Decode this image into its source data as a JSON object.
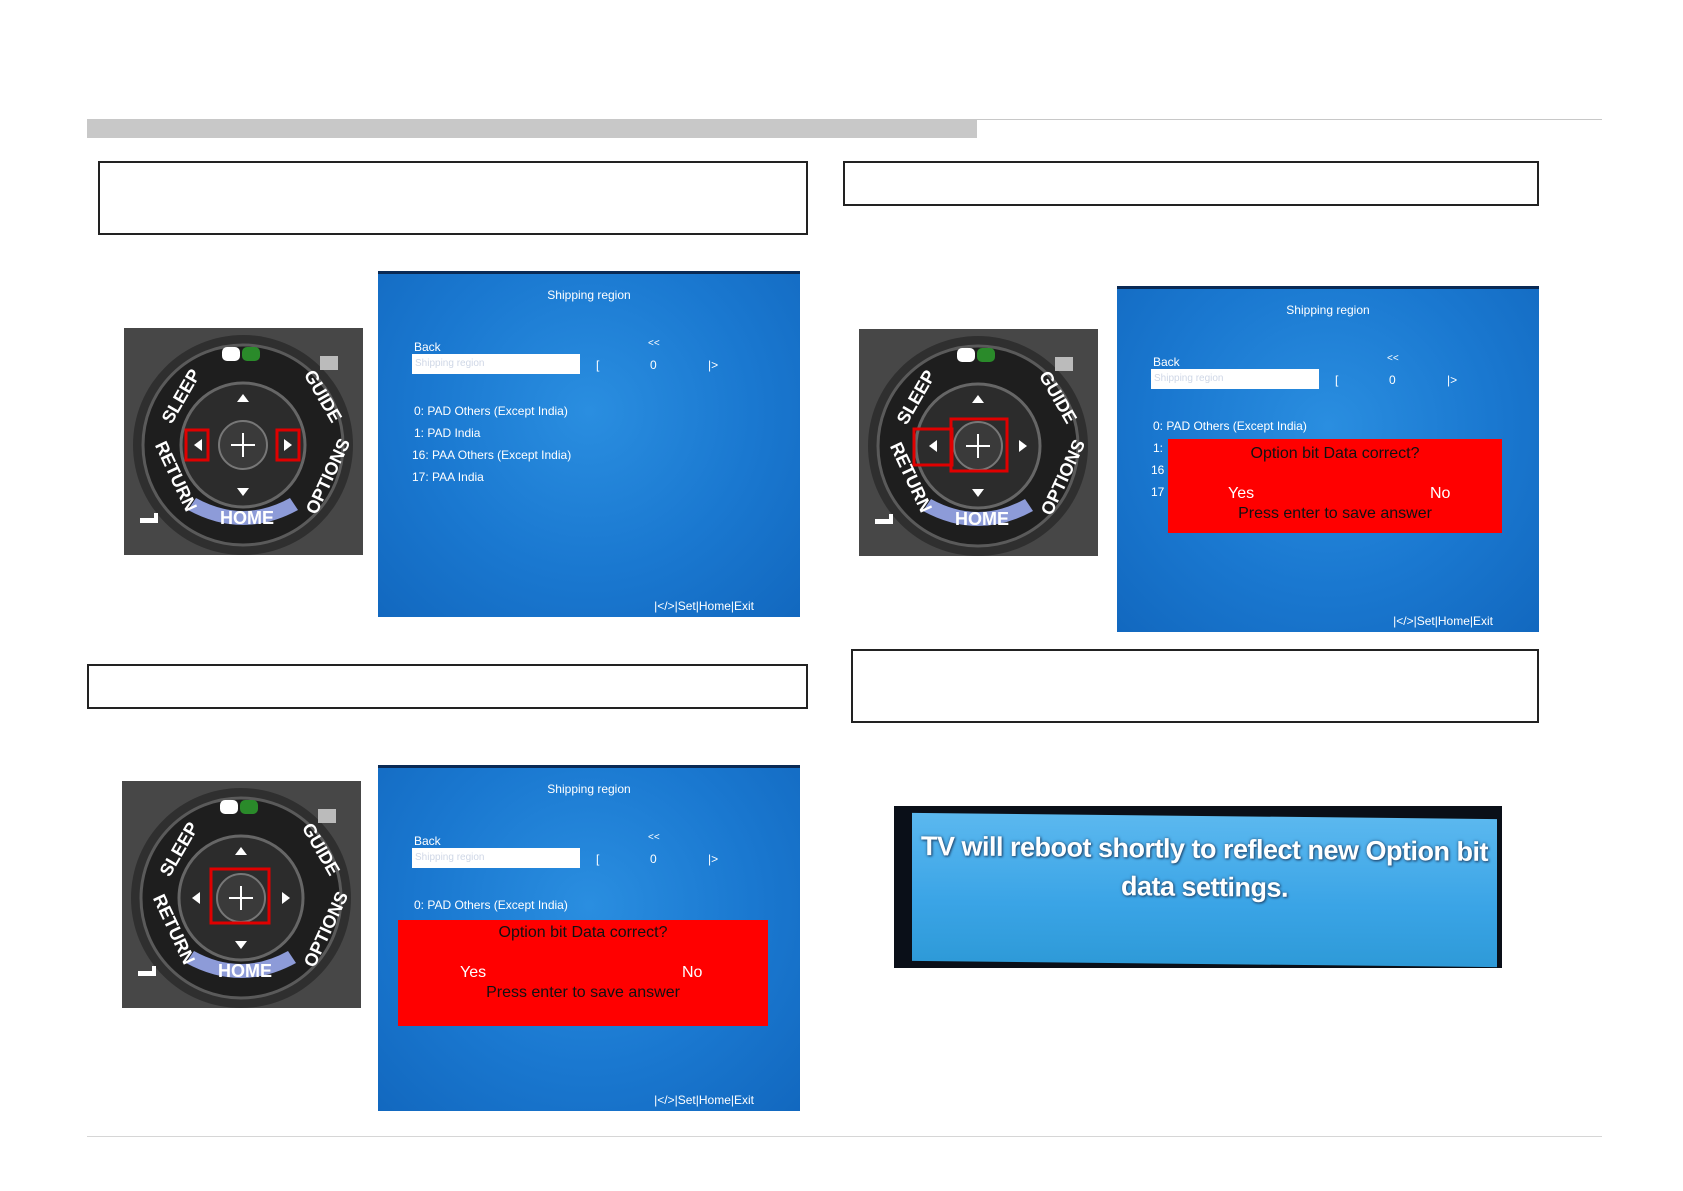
{
  "remote": {
    "sleep": "SLEEP",
    "guide": "GUIDE",
    "return": "RETURN",
    "options": "OPTIONS",
    "home": "HOME"
  },
  "screens": [
    {
      "title": "Shipping region",
      "back": "Back",
      "arrows": "<<",
      "field": "Shipping region",
      "bracket": "[",
      "value": "0",
      "next": "|>",
      "options": [
        "0: PAD Others (Except India)",
        "1: PAD India",
        "16: PAA Others (Except India)",
        "17: PAA India"
      ],
      "footer": "|</>|Set|Home|Exit"
    },
    {
      "title": "Shipping region",
      "back": "Back",
      "arrows": "<<",
      "field": "Shipping region",
      "bracket": "[",
      "value": "0",
      "next": "|>",
      "options": [
        "0: PAD Others (Except India)",
        "1:",
        "16",
        "17"
      ],
      "dialog": {
        "question": "Option bit Data correct?",
        "yes": "Yes",
        "no": "No",
        "prompt": "Press enter to save answer"
      },
      "footer": "|</>|Set|Home|Exit"
    },
    {
      "title": "Shipping region",
      "back": "Back",
      "arrows": "<<",
      "field": "Shipping region",
      "bracket": "[",
      "value": "0",
      "next": "|>",
      "options": [
        "0: PAD Others (Except India)"
      ],
      "dialog": {
        "question": "Option bit Data correct?",
        "yes": "Yes",
        "no": "No",
        "prompt": "Press enter to save answer"
      },
      "footer": "|</>|Set|Home|Exit"
    }
  ],
  "reboot": {
    "line1": "TV will reboot shortly to reflect new Option bit",
    "line2": "data settings."
  },
  "colors": {
    "highlight": "#e00000",
    "dialog": "#ff0000",
    "screen": "#1a78d0"
  }
}
